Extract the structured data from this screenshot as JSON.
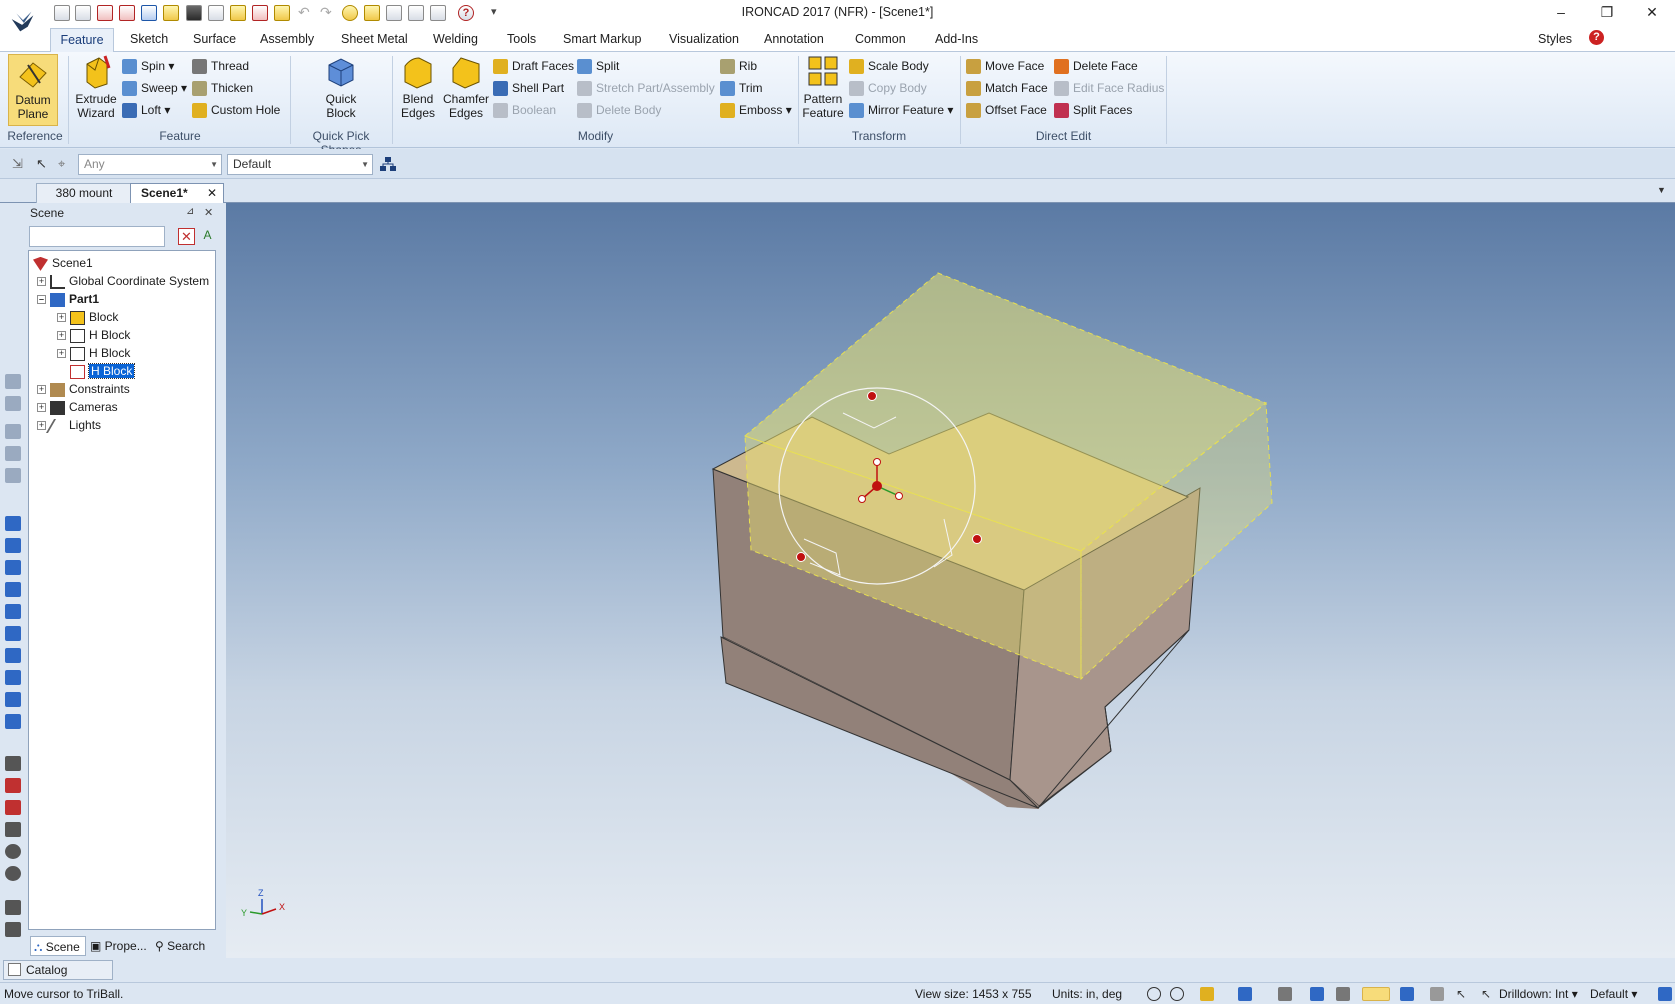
{
  "window": {
    "title": "IRONCAD 2017 (NFR) - [Scene1*]",
    "minimize": "–",
    "restore": "❐",
    "close": "✕"
  },
  "quick_access": [
    "new-file-icon",
    "new-scene-icon",
    "new-drawing-icon",
    "new-part-icon",
    "new-catalog-icon",
    "open-folder-icon",
    "save-icon",
    "save-as-icon",
    "fx-icon",
    "add-icon",
    "import-icon",
    "undo-icon",
    "redo-icon",
    "triball-icon",
    "smart-snap-icon",
    "select-icon",
    "list-icon",
    "copy-icon",
    "help-icon"
  ],
  "quick_access_more": "▾",
  "ribbon": {
    "tabs": [
      "Feature",
      "Sketch",
      "Surface",
      "Assembly",
      "Sheet Metal",
      "Welding",
      "Tools",
      "Smart Markup",
      "Visualization",
      "Annotation",
      "Common",
      "Add-Ins"
    ],
    "active_tab": "Feature",
    "styles_label": "Styles",
    "groups": {
      "reference": {
        "label": "Reference",
        "datum_plane": "Datum Plane"
      },
      "feature": {
        "label": "Feature",
        "extrude_wizard": "Extrude Wizard",
        "spin": "Spin",
        "sweep": "Sweep",
        "loft": "Loft",
        "thread": "Thread",
        "thicken": "Thicken",
        "custom_hole": "Custom Hole"
      },
      "quick_pick": {
        "label": "Quick Pick Shapes",
        "quick_block": "Quick Block"
      },
      "modify": {
        "label": "Modify",
        "blend_edges": "Blend Edges",
        "chamfer_edges": "Chamfer Edges",
        "draft_faces": "Draft Faces",
        "shell_part": "Shell Part",
        "boolean": "Boolean",
        "split": "Split",
        "stretch": "Stretch Part/Assembly",
        "delete_body": "Delete Body",
        "rib": "Rib",
        "trim": "Trim",
        "emboss": "Emboss"
      },
      "transform": {
        "label": "Transform",
        "pattern_feature": "Pattern Feature",
        "scale_body": "Scale Body",
        "copy_body": "Copy Body",
        "mirror_feature": "Mirror Feature"
      },
      "direct_edit": {
        "label": "Direct Edit",
        "move_face": "Move Face",
        "match_face": "Match Face",
        "offset_face": "Offset Face",
        "delete_face": "Delete Face",
        "edit_face_radius": "Edit Face Radius",
        "split_faces": "Split Faces"
      }
    }
  },
  "filterbar": {
    "filter_value": "Any",
    "style_value": "Default"
  },
  "doc_tabs": [
    {
      "label": "380 mount"
    },
    {
      "label": "Scene1*"
    }
  ],
  "scene_panel": {
    "title": "Scene",
    "pin": "⊿",
    "close": "✕",
    "search_placeholder": "",
    "tree": [
      {
        "label": "Scene1"
      },
      {
        "label": "Global Coordinate System"
      },
      {
        "label": "Part1"
      },
      {
        "label": "Block"
      },
      {
        "label": "H Block"
      },
      {
        "label": "H Block"
      },
      {
        "label": "H Block"
      },
      {
        "label": "Constraints"
      },
      {
        "label": "Cameras"
      },
      {
        "label": "Lights"
      }
    ],
    "tabs": [
      "Scene",
      "Prope...",
      "Search"
    ]
  },
  "catalog_browser": "Catalog Browser",
  "status": {
    "message": "Move cursor to TriBall.",
    "view_size": "View size: 1453 x 755",
    "units": "Units: in, deg",
    "drilldown": "Drilldown: Int",
    "style": "Default"
  },
  "viewport": {
    "axis_labels": {
      "x": "X",
      "y": "Y",
      "z": "Z"
    }
  },
  "colors": {
    "accent": "#1a3d7a",
    "selection": "#0a64d6",
    "part_fill": "#9a8880",
    "preview_fill": "#e8e070",
    "triball_handle": "#c01010"
  }
}
